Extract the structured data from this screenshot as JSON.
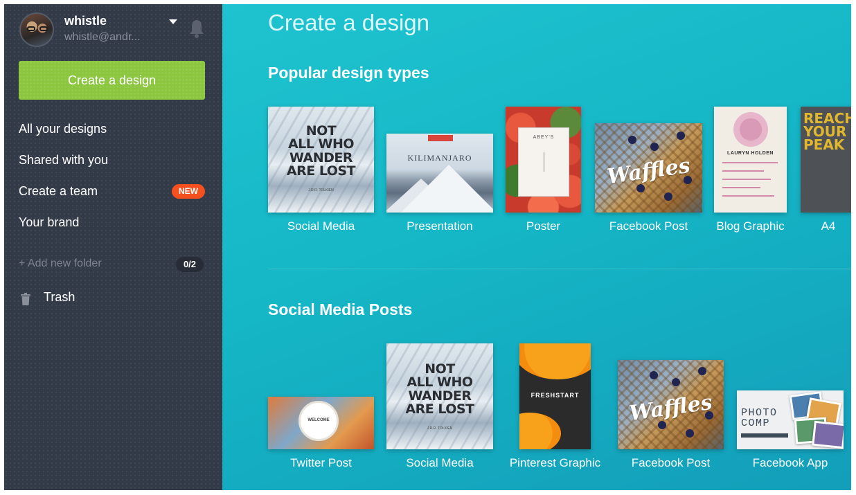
{
  "user": {
    "name": "whistle",
    "email": "whistle@andr..."
  },
  "sidebar": {
    "create_button": "Create a design",
    "nav": [
      {
        "label": "All your designs"
      },
      {
        "label": "Shared with you"
      },
      {
        "label": "Create a team",
        "badge": "NEW"
      },
      {
        "label": "Your brand"
      }
    ],
    "add_folder": "+ Add new folder",
    "folder_count": "0/2",
    "trash": "Trash"
  },
  "main": {
    "title": "Create a design",
    "popular": {
      "heading": "Popular design types",
      "items": [
        {
          "label": "Social Media",
          "art_text": "NOT ALL WHO WANDER ARE LOST",
          "art_sub": "J.R.R. TOLKIEN"
        },
        {
          "label": "Presentation",
          "art_text": "KILIMANJARO"
        },
        {
          "label": "Poster",
          "art_text": "ABEY'S"
        },
        {
          "label": "Facebook Post",
          "art_text": "Waffles"
        },
        {
          "label": "Blog Graphic",
          "art_text": "LAURYN HOLDEN"
        },
        {
          "label": "A4",
          "art_text": "REACH YOUR PEAK"
        }
      ]
    },
    "social": {
      "heading": "Social Media Posts",
      "items": [
        {
          "label": "Twitter Post"
        },
        {
          "label": "Social Media",
          "art_text": "NOT ALL WHO WANDER ARE LOST",
          "art_sub": "J.R.R. TOLKIEN"
        },
        {
          "label": "Pinterest Graphic",
          "art_text": "FRESHSTART"
        },
        {
          "label": "Facebook Post",
          "art_text": "Waffles"
        },
        {
          "label": "Facebook App",
          "art_text": "PHOTO COMP"
        }
      ]
    }
  },
  "colors": {
    "sidebar_bg": "#333a48",
    "create_button": "#8cc63f",
    "new_badge": "#f4511e",
    "main_bg": "#17b8c8"
  }
}
